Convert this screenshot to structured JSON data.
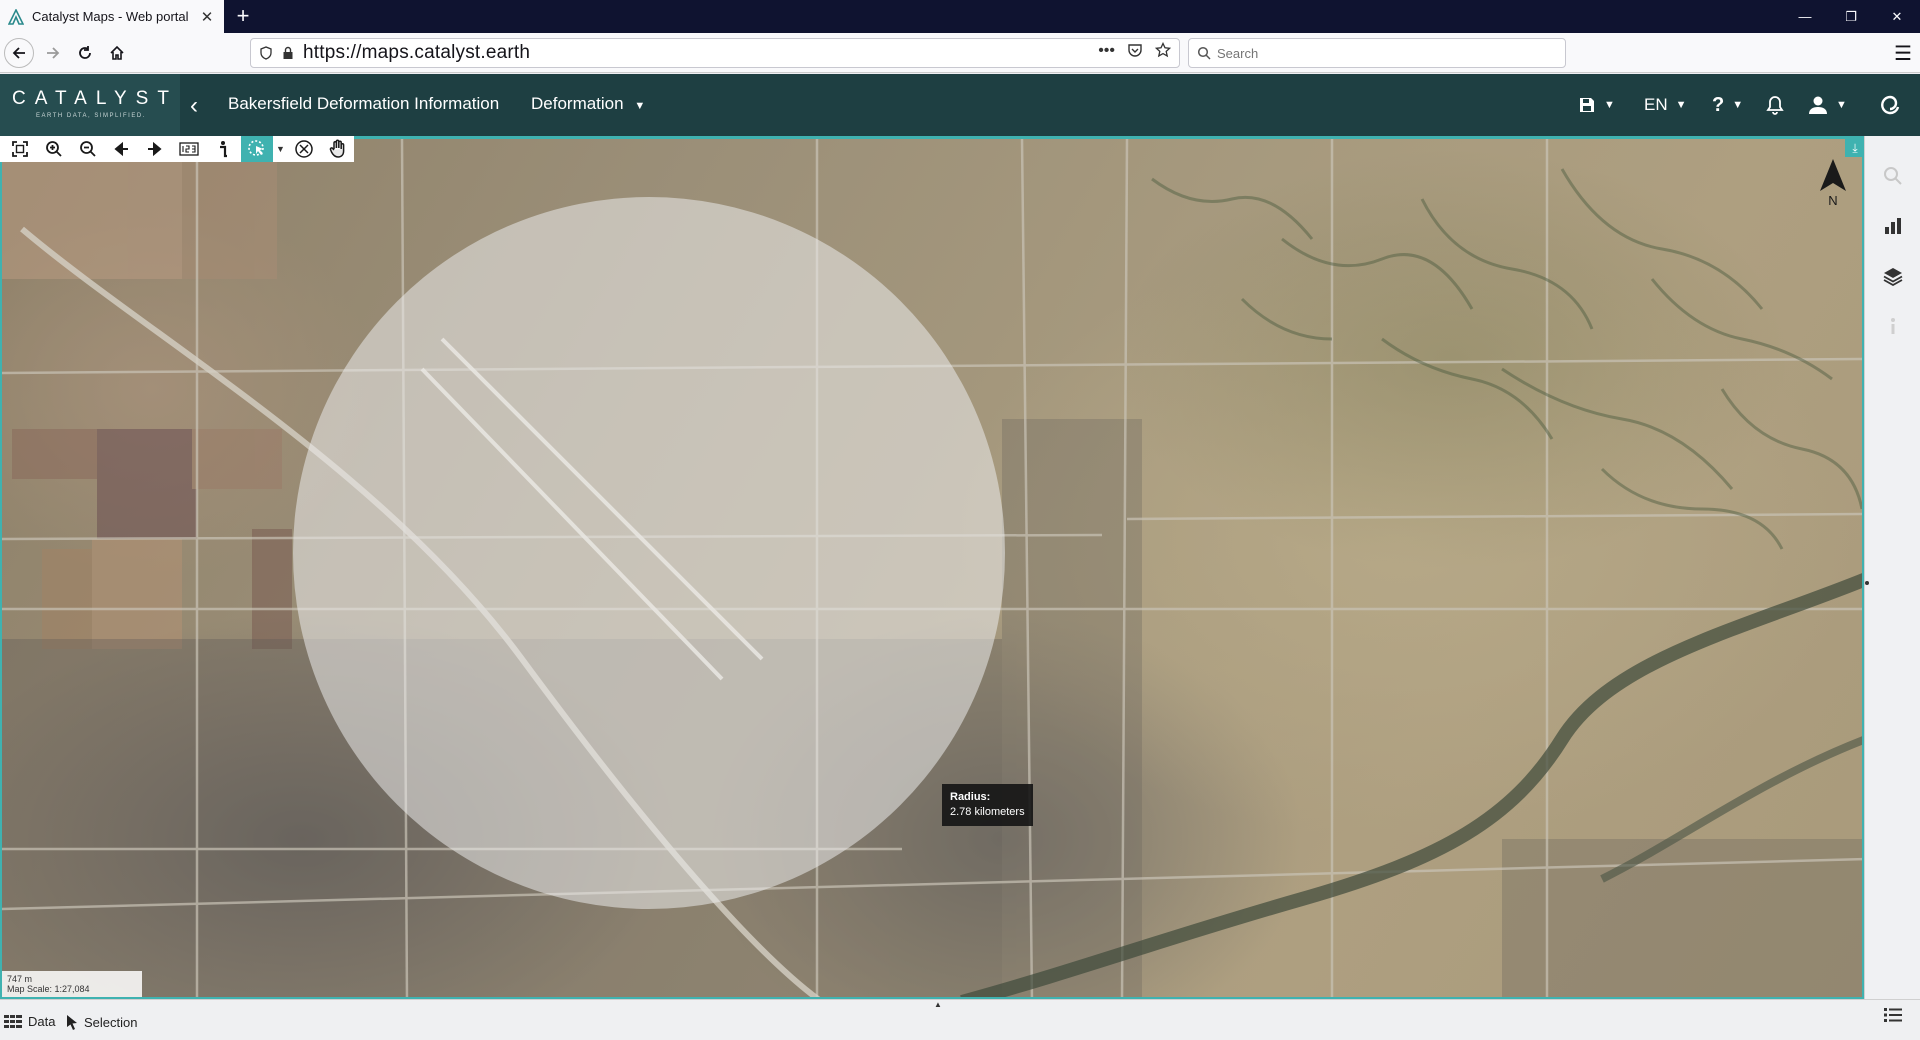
{
  "browser": {
    "tab_title": "Catalyst Maps - Web portal",
    "url": "https://maps.catalyst.earth",
    "search_placeholder": "Search",
    "url_actions": "•••"
  },
  "app": {
    "logo": "CATALYST",
    "logo_tagline": "EARTH DATA, SIMPLIFIED.",
    "title": "Bakersfield Deformation Information",
    "layer_dropdown": "Deformation",
    "language": "EN"
  },
  "map": {
    "tooltip_title": "Radius:",
    "tooltip_value": "2.78 kilometers",
    "north_label": "N",
    "scale_length": "747 m",
    "scale_text": "Map Scale: 1:27,084"
  },
  "status": {
    "data_label": "Data",
    "selection_label": "Selection"
  },
  "colors": {
    "header": "#1e3f42",
    "accent": "#3fb2b0"
  }
}
